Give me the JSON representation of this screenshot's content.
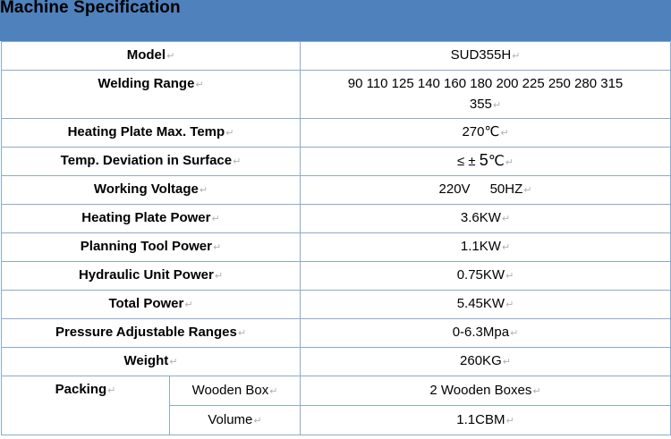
{
  "header": {
    "title": "Machine Specification"
  },
  "mark": "↵",
  "specs": [
    {
      "label": "Model",
      "value": "SUD355H"
    },
    {
      "label": "Welding Range",
      "value_line1": "90 110 125 140 160 180 200 225 250 280 315",
      "value_line2": "355"
    },
    {
      "label": "Heating Plate Max. Temp",
      "value": "270℃"
    },
    {
      "label": "Temp. Deviation in Surface",
      "value_prefix": "≤ ± ",
      "value_num": "5",
      "value_unit": "℃"
    },
    {
      "label": "Working Voltage",
      "value_a": "220V",
      "value_b": "50HZ"
    },
    {
      "label": "Heating Plate Power",
      "value": "3.6KW"
    },
    {
      "label": "Planning Tool Power",
      "value": "1.1KW"
    },
    {
      "label": "Hydraulic Unit Power",
      "value": "0.75KW"
    },
    {
      "label": "Total Power",
      "value": "5.45KW"
    },
    {
      "label": "Pressure Adjustable Ranges",
      "value": "0-6.3Mpa"
    },
    {
      "label": "Weight",
      "value": "260KG"
    }
  ],
  "packing": {
    "label": "Packing",
    "rows": [
      {
        "label": "Wooden Box",
        "value": "2 Wooden Boxes"
      },
      {
        "label": "Volume",
        "value": "1.1CBM"
      }
    ]
  }
}
